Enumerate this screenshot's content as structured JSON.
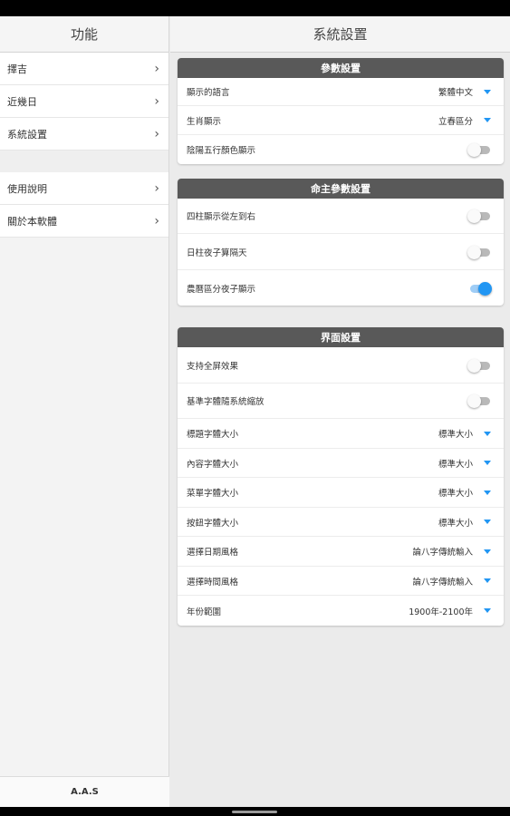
{
  "left_panel": {
    "title": "功能",
    "group1": [
      {
        "label": "擇吉"
      },
      {
        "label": "近幾日"
      },
      {
        "label": "系統設置"
      }
    ],
    "group2": [
      {
        "label": "使用說明"
      },
      {
        "label": "關於本軟體"
      }
    ],
    "footer": "A.A.S"
  },
  "right_panel": {
    "title": "系統設置",
    "param_section": {
      "title": "參數設置",
      "display_language": {
        "label": "顯示的語言",
        "value": "繁體中文"
      },
      "zodiac_display": {
        "label": "生肖顯示",
        "value": "立春區分"
      },
      "yinyang_color": {
        "label": "陰陽五行顏色顯示",
        "on": false
      }
    },
    "owner_section": {
      "title": "命主參數設置",
      "four_pillars": {
        "label": "四柱顯示從左到右",
        "on": false
      },
      "day_pillar": {
        "label": "日柱夜子算隔天",
        "on": false
      },
      "zi_hour": {
        "label": "農曆區分夜子顯示",
        "on": true
      }
    },
    "ui_section": {
      "title": "界面設置",
      "fullscreen": {
        "label": "支持全屏效果",
        "on": false
      },
      "system_scale": {
        "label": "基準字體隨系統縮放",
        "on": false
      },
      "title_font": {
        "label": "標題字體大小",
        "value": "標準大小"
      },
      "content_font": {
        "label": "內容字體大小",
        "value": "標準大小"
      },
      "menu_font": {
        "label": "菜單字體大小",
        "value": "標準大小"
      },
      "button_font": {
        "label": "按鈕字體大小",
        "value": "標準大小"
      },
      "date_style": {
        "label": "選擇日期風格",
        "value": "論八字傳統輸入"
      },
      "time_style": {
        "label": "選擇時間風格",
        "value": "論八字傳統輸入"
      },
      "year_range": {
        "label": "年份範圍",
        "value": "1900年-2100年"
      }
    }
  },
  "colors": {
    "accent": "#2196f3",
    "section_header": "#595959",
    "toggle_off": "#b9b9b9"
  },
  "icons": {
    "chevron": "›"
  }
}
